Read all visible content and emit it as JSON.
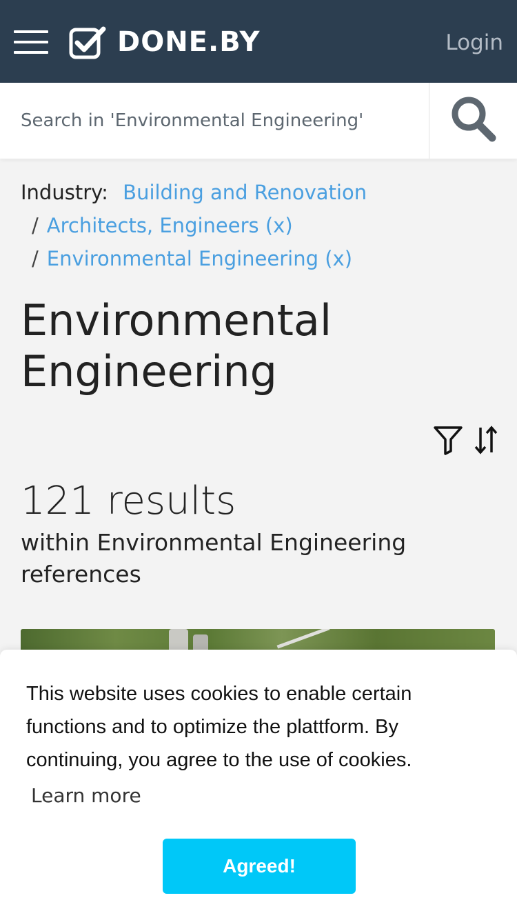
{
  "header": {
    "brand": "DONE.BY",
    "login_label": "Login",
    "background_color": "#2c3e50",
    "icons": {
      "menu": "hamburger-menu-icon",
      "logo": "checkbox-check-logo-icon"
    }
  },
  "search": {
    "placeholder": "Search in 'Environmental Engineering'",
    "value": "",
    "button_icon": "search-icon"
  },
  "breadcrumb": {
    "label": "Industry:",
    "items": [
      {
        "label": "Building and Renovation"
      },
      {
        "label": "Architects, Engineers (x)"
      },
      {
        "label": "Environmental Engineering (x)"
      }
    ],
    "separator": "/",
    "link_color": "#4a9fe0"
  },
  "main": {
    "title": "Environmental Engineering",
    "results_count": "121 results",
    "results_subtitle": "within Environmental Engineering references",
    "toolbar_icons": [
      "filter-icon",
      "sort-icon"
    ]
  },
  "cookie_banner": {
    "message": "This website uses cookies to enable certain functions and to optimize the plattform. By continuing, you agree to the use of cookies.",
    "learn_more": "Learn more",
    "accept_label": "Agreed!",
    "accept_color": "#00c8f8"
  }
}
